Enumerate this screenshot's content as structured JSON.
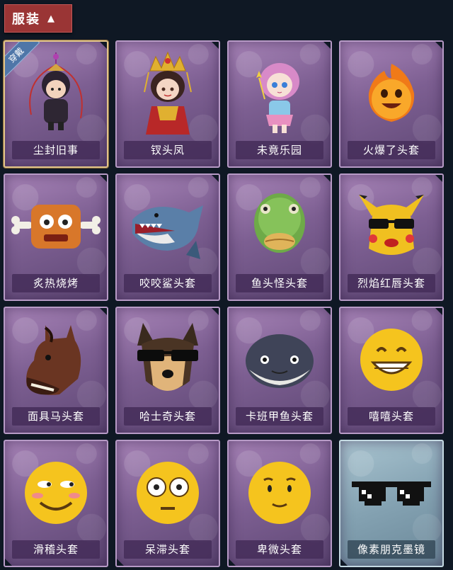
{
  "header": {
    "title": "服装",
    "toggle_icon": "chevron-up-icon"
  },
  "items": [
    {
      "name": "尘封旧事",
      "icon": "chibi-character-icon",
      "badge": "穿戴"
    },
    {
      "name": "钗头凤",
      "icon": "crowned-empress-icon"
    },
    {
      "name": "未竟乐园",
      "icon": "fairy-girl-icon"
    },
    {
      "name": "火爆了头套",
      "icon": "fireball-head-icon"
    },
    {
      "name": "炙热烧烤",
      "icon": "meat-block-head-icon"
    },
    {
      "name": "咬咬鲨头套",
      "icon": "shark-head-icon"
    },
    {
      "name": "鱼头怪头套",
      "icon": "fish-head-icon"
    },
    {
      "name": "烈焰红唇头套",
      "icon": "yellow-pikachu-mask-icon"
    },
    {
      "name": "面具马头套",
      "icon": "horse-mask-icon"
    },
    {
      "name": "哈士奇头套",
      "icon": "husky-mask-icon"
    },
    {
      "name": "卡班甲鱼头套",
      "icon": "turtle-head-icon"
    },
    {
      "name": "嘻嘻头套",
      "icon": "grinning-emoji-icon"
    },
    {
      "name": "滑稽头套",
      "icon": "funny-emoji-icon"
    },
    {
      "name": "呆滞头套",
      "icon": "dazed-emoji-icon"
    },
    {
      "name": "卑微头套",
      "icon": "humble-emoji-icon"
    },
    {
      "name": "像素朋克墨镜",
      "icon": "pixel-sunglasses-icon"
    }
  ],
  "colors": {
    "background": "#0f1824",
    "header_tab": "#9a3535",
    "card_purple": "#8a6aa2",
    "card_blue": "#84a2b2",
    "selected_border": "#e0c48a",
    "badge": "#4f76a8"
  }
}
